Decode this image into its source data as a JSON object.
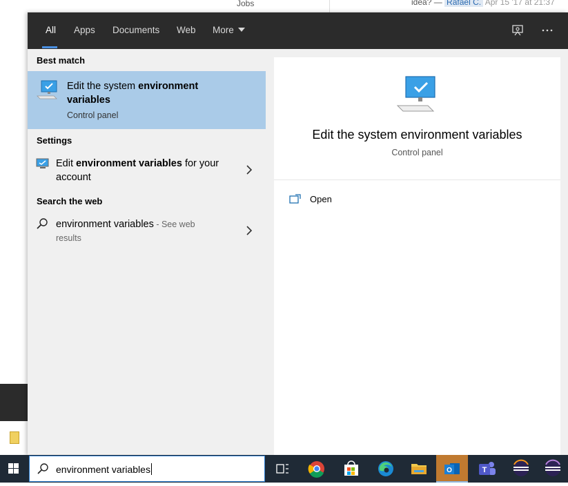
{
  "background": {
    "jobs_label": "Jobs",
    "user_prefix": "idea? —",
    "user_tag": "Rafael C.",
    "user_date": "Apr 15 '17 at 21:37"
  },
  "tabs": [
    {
      "label": "All",
      "active": true
    },
    {
      "label": "Apps",
      "active": false
    },
    {
      "label": "Documents",
      "active": false
    },
    {
      "label": "Web",
      "active": false
    },
    {
      "label": "More",
      "active": false
    }
  ],
  "topbar_icons": [
    "feedback-icon",
    "more-options-icon"
  ],
  "results": {
    "best_match_header": "Best match",
    "best_match": {
      "title_pre": "Edit the system ",
      "title_bold_1": "environment",
      "title_bold_2": "variables",
      "subtitle": "Control panel",
      "icon": "computer-monitor-icon"
    },
    "settings_header": "Settings",
    "settings_item": {
      "pre": "Edit ",
      "bold": "environment variables",
      "post": " for your account",
      "icon": "monitor-settings-icon"
    },
    "web_header": "Search the web",
    "web_item": {
      "query": "environment variables",
      "suffix": " - See web results",
      "icon": "search-icon"
    }
  },
  "detail": {
    "title": "Edit the system environment variables",
    "subtitle": "Control panel",
    "actions": [
      {
        "label": "Open",
        "icon": "open-icon"
      }
    ]
  },
  "taskbar": {
    "search_value": "environment variables",
    "apps": [
      "task-view-icon",
      "chrome-icon",
      "store-icon",
      "edge-icon",
      "file-explorer-icon",
      "outlook-icon",
      "teams-icon",
      "eclipse-icon",
      "eclipse-icon-2"
    ],
    "accent": "#2d7fd3",
    "background": "#1f2a36"
  },
  "colors": {
    "selection": "#aacbe8",
    "topbar": "#2b2b2b",
    "panel": "#f0f0f0",
    "tab_underline": "#4a90e2"
  }
}
